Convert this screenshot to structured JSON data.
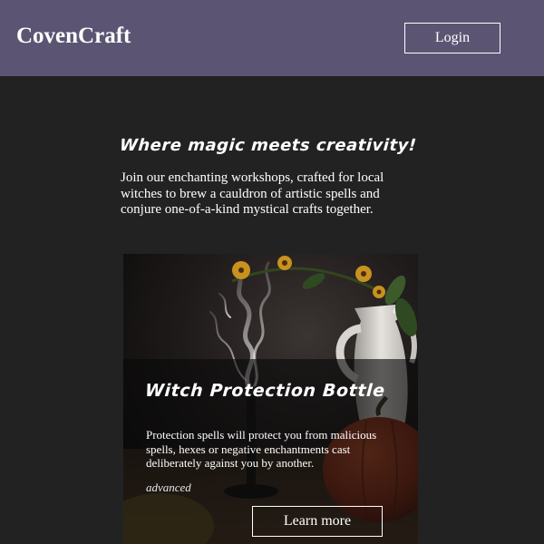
{
  "header": {
    "brand": "CovenCraft",
    "login_label": "Login",
    "background_color": "#5b5573"
  },
  "hero": {
    "tagline": "Where magic meets creativity!",
    "intro": "Join our enchanting workshops, crafted for local witches to brew a cauldron of artistic spells and conjure one-of-a-kind mystical crafts together."
  },
  "workshop_card": {
    "title": "Witch Protection Bottle",
    "description": "Protection spells will protect you from malicious spells, hexes or negative enchantments cast deliberately against you by another.",
    "level": "advanced",
    "button_label": "Learn more",
    "image_subject": "smoking candle, white ceramic pitcher, yellow flowers, pumpkin on dark table"
  },
  "colors": {
    "page_background": "#222222",
    "text": "#ffffff"
  }
}
